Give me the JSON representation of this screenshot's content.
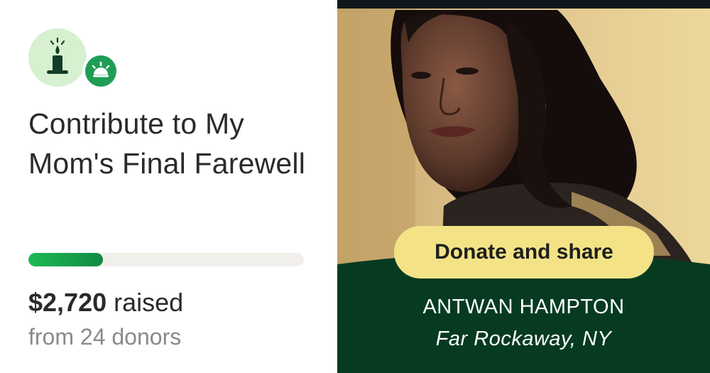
{
  "campaign": {
    "title": "Contribute to My Mom's Final Farewell",
    "icon": "candle-icon",
    "badge_icon": "sunrise-icon"
  },
  "progress": {
    "fraction": 0.27
  },
  "stats": {
    "amount": "$2,720",
    "raised_label": "raised",
    "donors_text": "from 24 donors"
  },
  "cta": {
    "label": "Donate and share"
  },
  "organizer": {
    "name": "ANTWAN HAMPTON",
    "location": "Far Rockaway, NY"
  },
  "colors": {
    "accent_green": "#1db954",
    "dark_green": "#063b22",
    "button_yellow": "#f4e386",
    "icon_bg": "#d7f0cf"
  }
}
